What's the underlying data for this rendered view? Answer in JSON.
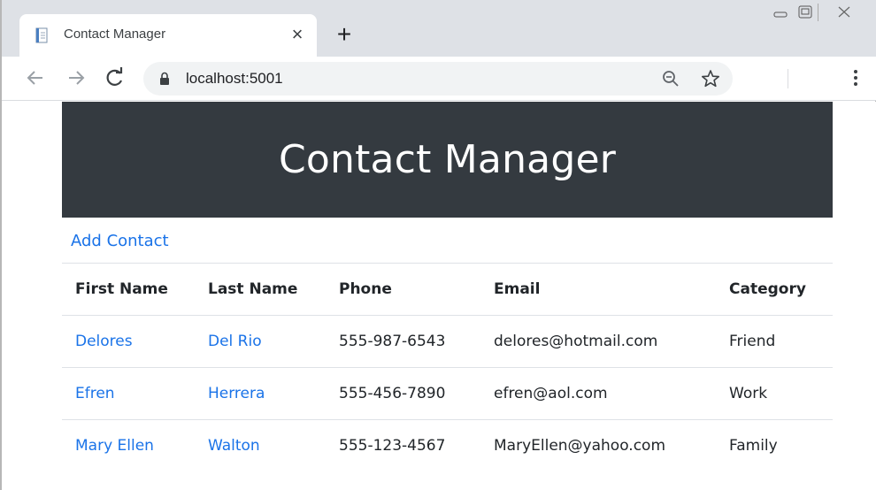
{
  "browser": {
    "tab": {
      "title": "Contact Manager",
      "close_icon": "×",
      "favicon_icon": "document-icon"
    },
    "new_tab_icon": "+",
    "address": {
      "url": "localhost:5001"
    },
    "colors": {
      "tabstrip": "#dee1e6",
      "omnibox": "#f1f3f4"
    }
  },
  "page": {
    "heading": "Contact Manager",
    "add_contact_label": "Add Contact",
    "table": {
      "headers": {
        "first_name": "First Name",
        "last_name": "Last Name",
        "phone": "Phone",
        "email": "Email",
        "category": "Category"
      },
      "rows": [
        {
          "first_name": "Delores",
          "last_name": "Del Rio",
          "phone": "555-987-6543",
          "email": "delores@hotmail.com",
          "category": "Friend"
        },
        {
          "first_name": "Efren",
          "last_name": "Herrera",
          "phone": "555-456-7890",
          "email": "efren@aol.com",
          "category": "Work"
        },
        {
          "first_name": "Mary Ellen",
          "last_name": "Walton",
          "phone": "555-123-4567",
          "email": "MaryEllen@yahoo.com",
          "category": "Family"
        }
      ]
    },
    "colors": {
      "hero_bg": "#343a40",
      "link": "#1a73e8",
      "text": "#212529"
    }
  }
}
